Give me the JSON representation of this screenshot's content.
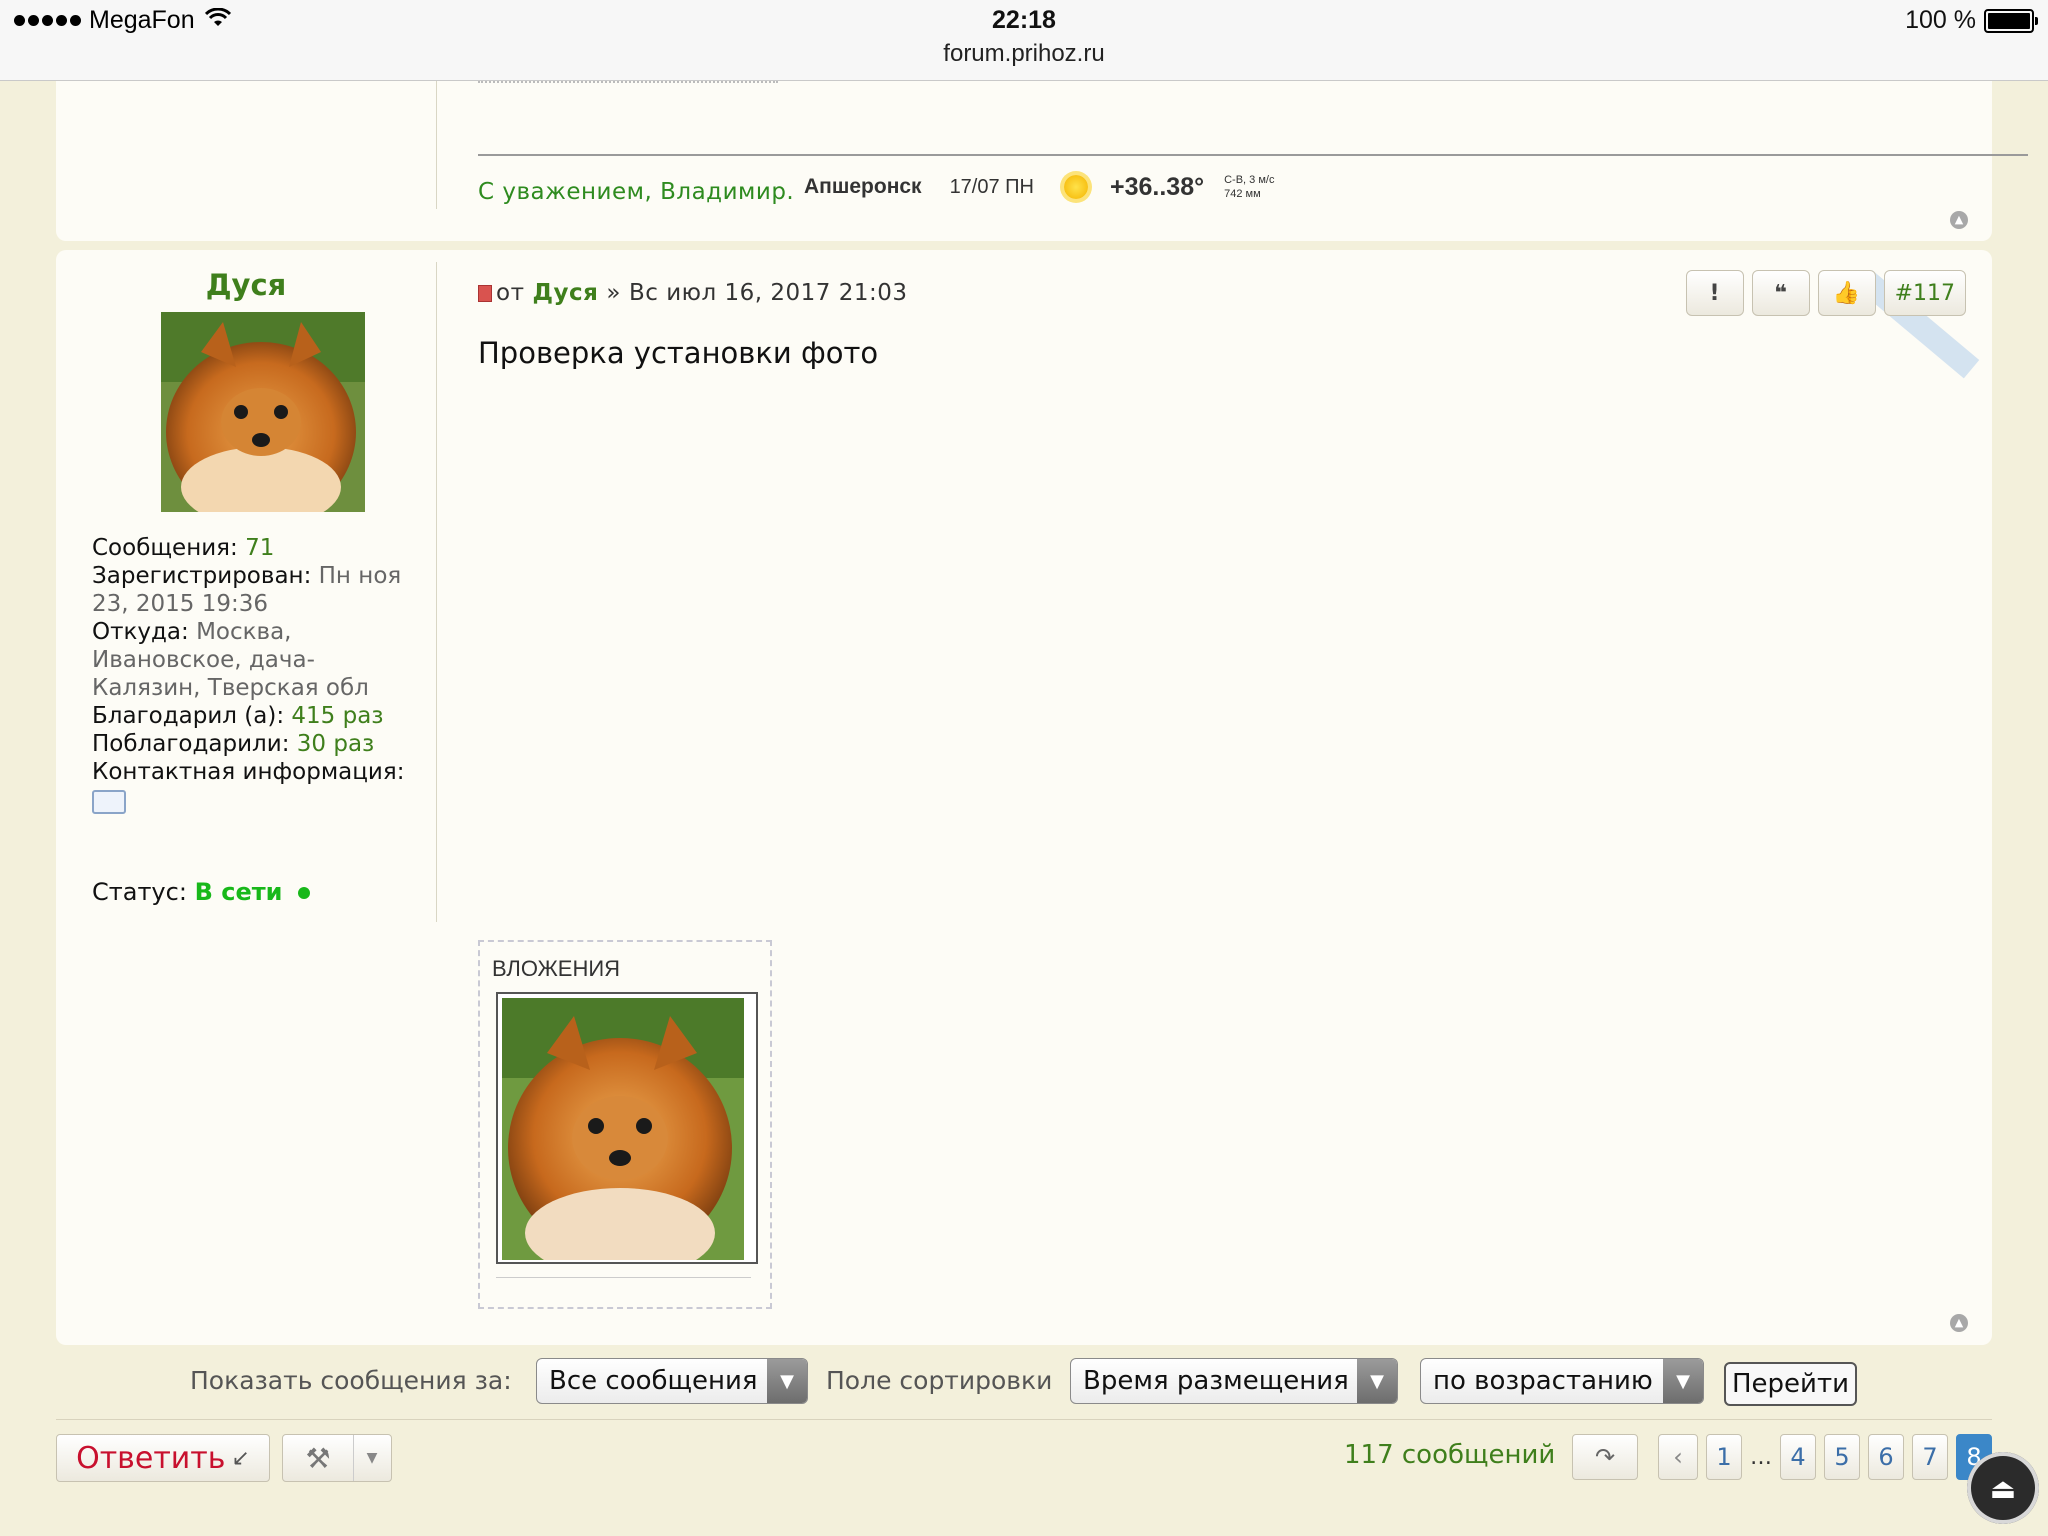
{
  "status_bar": {
    "carrier": "MegaFon",
    "time": "22:18",
    "url": "forum.prihoz.ru",
    "battery": "100 %"
  },
  "prev_post": {
    "signature": "С уважением, Владимир.",
    "weather": {
      "city": "Апшеронск",
      "date": "17/07 ПН",
      "temp": "+36..38°",
      "wind": "С-В, 3 м/с",
      "pressure": "742 мм"
    }
  },
  "post": {
    "author": "Дуся",
    "profile": {
      "messages_label": "Сообщения:",
      "messages_value": "71",
      "registered_label": "Зарегистрирован:",
      "registered_value": "Пн ноя 23, 2015 19:36",
      "from_label": "Откуда:",
      "from_value": "Москва, Ивановское, дача-Калязин, Тверская обл",
      "thanked_label": "Благодарил (а):",
      "thanked_value": "415 раз",
      "was_thanked_label": "Поблагодарили:",
      "was_thanked_value": "30 раз",
      "contact_label": "Контактная информация:",
      "status_label": "Статус:",
      "status_value": "В сети"
    },
    "header": {
      "from": "от",
      "author": "Дуся",
      "separator": "»",
      "datetime": "Вс июл 16, 2017 21:03"
    },
    "buttons": {
      "report": "!",
      "quote": "❝",
      "like": "👍",
      "number": "#117"
    },
    "body": "Проверка установки фото",
    "attachments_title": "ВЛОЖЕНИЯ"
  },
  "sort_bar": {
    "show_label": "Показать сообщения за:",
    "show_value": "Все сообщения",
    "sort_label": "Поле сортировки",
    "sort_value": "Время размещения",
    "order_value": "по возрастанию",
    "go_button": "Перейти"
  },
  "bottom": {
    "reply_button": "Ответить",
    "count": "117 сообщений",
    "pages": [
      "1",
      "4",
      "5",
      "6",
      "7",
      "8"
    ],
    "ellipsis": "…",
    "active_page": "8"
  }
}
